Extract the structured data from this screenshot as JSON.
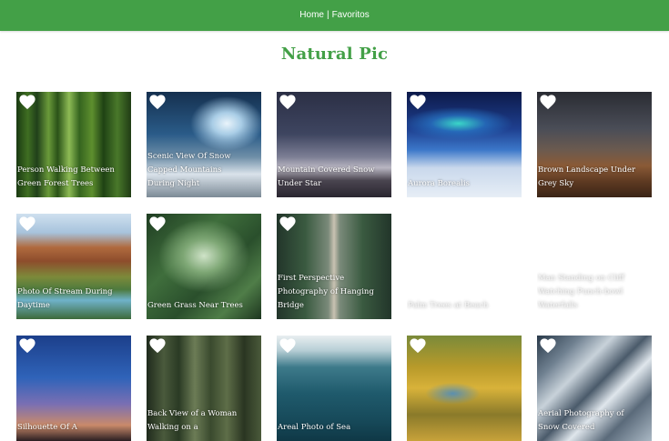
{
  "nav": {
    "home": "Home",
    "separator": "|",
    "favorites": "Favoritos"
  },
  "title": "Natural Pic",
  "colors": {
    "brand": "#43a047",
    "heart": "#ffffff"
  },
  "favorite_icon": "heart-icon",
  "cards": [
    {
      "caption": "Person Walking Between Green Forest Trees"
    },
    {
      "caption": "Scenic View Of Snow Capped Mountains During Night"
    },
    {
      "caption": "Mountain Covered Snow Under Star"
    },
    {
      "caption": "Aurora Borealis"
    },
    {
      "caption": "Brown Landscape Under Grey Sky"
    },
    {
      "caption": "Photo Of Stream During Daytime"
    },
    {
      "caption": "Green Grass Near Trees"
    },
    {
      "caption": "First Perspective Photography of Hanging Bridge"
    },
    {
      "caption": "Palm Trees at Beach"
    },
    {
      "caption": "Man Standing on Cliff Watching Punch-bowl Waterfalls"
    },
    {
      "caption": "Silhouette Of A"
    },
    {
      "caption": "Back View of a Woman Walking on a"
    },
    {
      "caption": "Areal Photo of Sea"
    },
    {
      "caption": ""
    },
    {
      "caption": "Aerial Photography of Snow Covered"
    }
  ]
}
